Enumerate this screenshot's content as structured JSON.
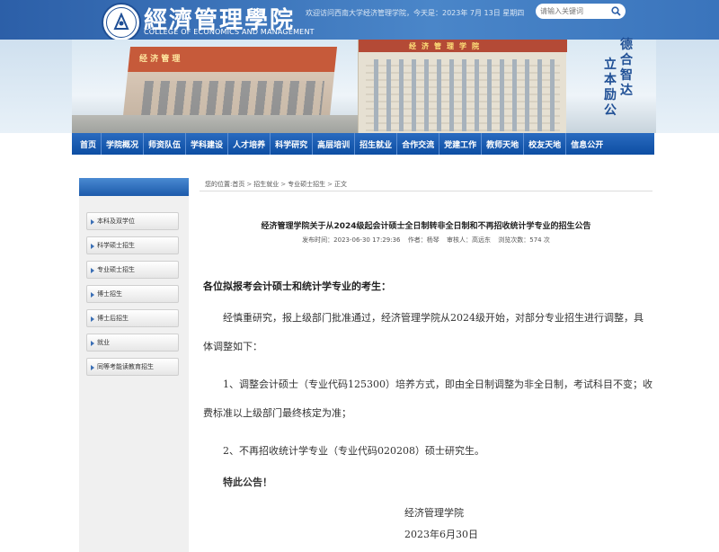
{
  "header": {
    "logo_cn": "經濟管理學院",
    "logo_en": "COLLEGE OF ECONOMICS AND MANAGEMENT",
    "welcome_text": "欢迎访问西南大学经济管理学院，今天是：2023年 7月 13日 星期四",
    "search": {
      "placeholder": "请输入关键词"
    },
    "motto": [
      "德",
      "合",
      "智",
      "达",
      "立",
      "本",
      "励",
      "公"
    ],
    "building_left_sign": "经 济 管 理",
    "building_main_sign": "经济管理学院"
  },
  "nav": {
    "items": [
      "首页",
      "学院概况",
      "师资队伍",
      "学科建设",
      "人才培养",
      "科学研究",
      "高层培训",
      "招生就业",
      "合作交流",
      "党建工作",
      "教师天地",
      "校友天地",
      "信息公开"
    ]
  },
  "sidebar": {
    "items": [
      "本科及双学位",
      "科学硕士招生",
      "专业硕士招生",
      "博士招生",
      "博士后招生",
      "就业",
      "同等考能读教育招生"
    ]
  },
  "breadcrumb": {
    "prefix": "您的位置:",
    "items": [
      "首页",
      "招生就业",
      "专业硕士招生",
      "正文"
    ],
    "sep": ">"
  },
  "article": {
    "title": "经济管理学院关于从2024级起会计硕士全日制转非全日制和不再招收统计学专业的招生公告",
    "meta": {
      "published": "发布时间：2023-06-30 17:29:36",
      "author": "作者：杨琴",
      "reviewer": "审核人：高远东",
      "views": "浏览次数：574 次"
    },
    "salutation": "各位拟报考会计硕士和统计学专业的考生：",
    "paragraphs": [
      "经慎重研究，报上级部门批准通过，经济管理学院从2024级开始，对部分专业招生进行调整，具体调整如下：",
      "1、调整会计硕士（专业代码125300）培养方式，即由全日制调整为非全日制，考试科目不变；收费标准以上级部门最终核定为准；",
      "2、不再招收统计学专业（专业代码020208）硕士研究生。"
    ],
    "notice": "特此公告！",
    "signature_org": "经济管理学院",
    "signature_date": "2023年6月30日"
  },
  "colors": {
    "nav_bg": "#0d4ea3",
    "topbar_bg": "#3d73b8",
    "motto": "#1f4f95"
  }
}
